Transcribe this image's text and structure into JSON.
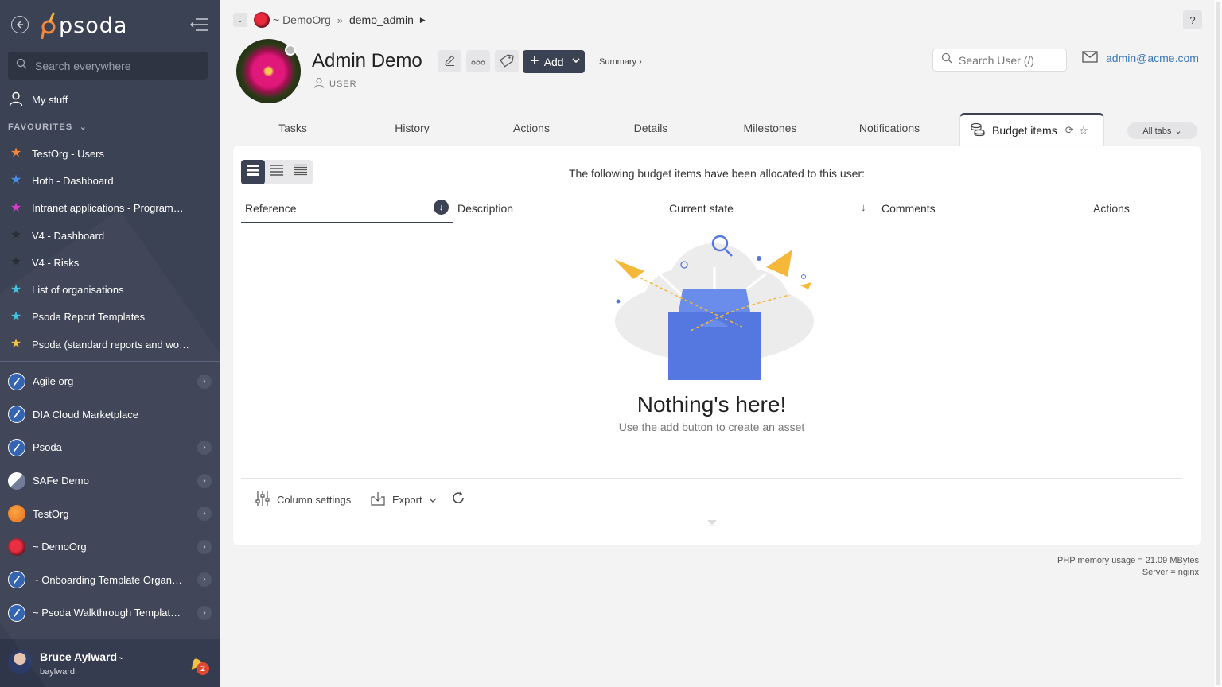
{
  "app": {
    "logo_text": "psoda"
  },
  "sidebar": {
    "search_placeholder": "Search everywhere",
    "my_stuff": "My stuff",
    "favourites_heading": "FAVOURITES",
    "favourites": [
      {
        "label": "TestOrg - Users",
        "color": "#f5863b"
      },
      {
        "label": "Hoth - Dashboard",
        "color": "#4a8ee8"
      },
      {
        "label": "Intranet applications - Programme…",
        "color": "#d63cc8"
      },
      {
        "label": "V4 - Dashboard",
        "color": "#2a2e38"
      },
      {
        "label": "V4 - Risks",
        "color": "#2a2e38"
      },
      {
        "label": "List of organisations",
        "color": "#38c3e0"
      },
      {
        "label": "Psoda Report Templates",
        "color": "#38c3e0"
      },
      {
        "label": "Psoda (standard reports and work…",
        "color": "#f2c03b"
      }
    ],
    "orgs": [
      {
        "label": "Agile org",
        "icon": "psoda-org-icon",
        "has_children": true
      },
      {
        "label": "DIA Cloud Marketplace",
        "icon": "psoda-org-icon",
        "has_children": false
      },
      {
        "label": "Psoda",
        "icon": "psoda-org-icon",
        "has_children": true
      },
      {
        "label": "SAFe Demo",
        "icon": "safe-org-icon",
        "has_children": true
      },
      {
        "label": "TestOrg",
        "icon": "orange-org-icon",
        "has_children": true
      },
      {
        "label": "~ DemoOrg",
        "icon": "flower-org-icon",
        "has_children": true
      },
      {
        "label": "~ Onboarding Template Organisa…",
        "icon": "psoda-org-icon",
        "has_children": true
      },
      {
        "label": "~ Psoda Walkthrough Template P…",
        "icon": "psoda-org-icon",
        "has_children": true
      }
    ],
    "user": {
      "name": "Bruce Aylward",
      "username": "baylward",
      "notifications": "2"
    }
  },
  "breadcrumb": {
    "org": "~ DemoOrg",
    "current": "demo_admin"
  },
  "header": {
    "title": "Admin Demo",
    "role": "USER",
    "add_label": "Add",
    "summary_label": "Summary ›",
    "search_placeholder": "Search User (/)",
    "email": "admin@acme.com",
    "help": "?"
  },
  "tabs": {
    "items": [
      "Tasks",
      "History",
      "Actions",
      "Details",
      "Milestones",
      "Notifications"
    ],
    "active": "Budget items",
    "all_tabs": "All tabs"
  },
  "panel": {
    "description": "The following budget items have been allocated to this user:",
    "columns": [
      "Reference",
      "Description",
      "Current state",
      "Comments",
      "Actions"
    ],
    "empty_title": "Nothing's here!",
    "empty_sub": "Use the add button to create an asset",
    "column_settings": "Column settings",
    "export": "Export"
  },
  "footer": {
    "memory": "PHP memory usage = 21.09 MBytes",
    "server": "Server = nginx"
  }
}
